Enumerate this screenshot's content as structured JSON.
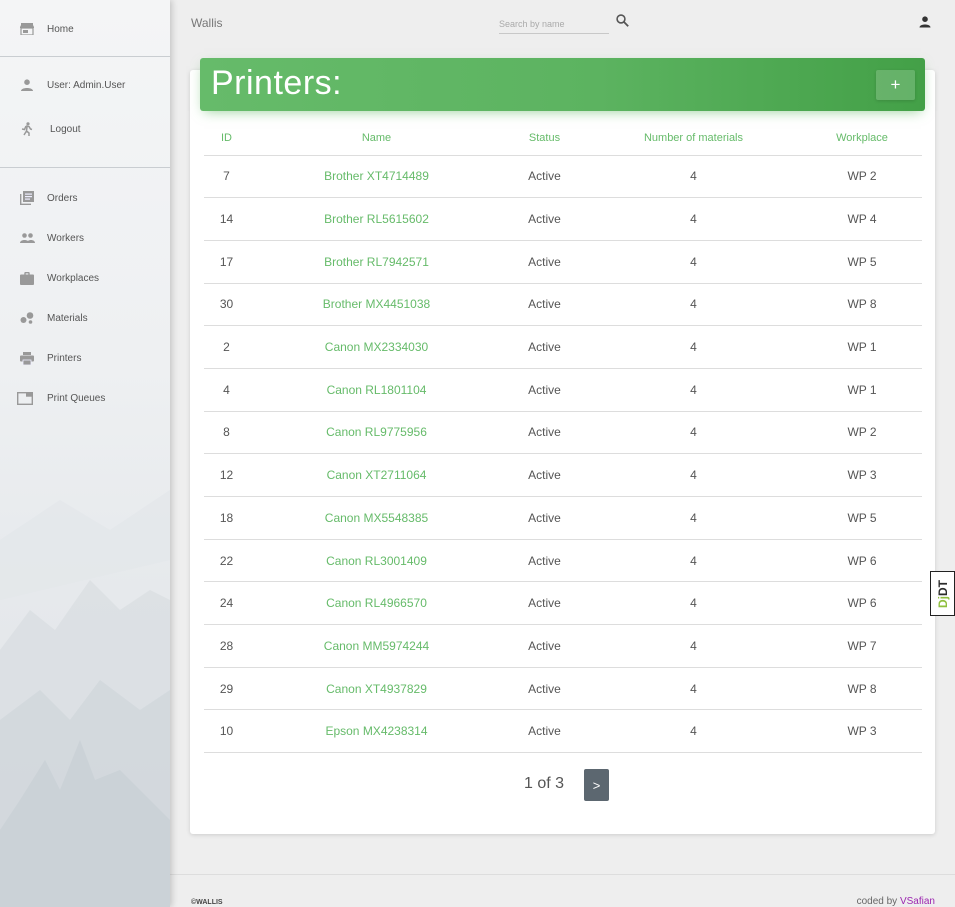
{
  "app": {
    "brand": "Wallis"
  },
  "sidebar": {
    "top_items": [
      {
        "label": "Home",
        "icon": "store-icon"
      }
    ],
    "user_items": [
      {
        "label": "User: Admin.User",
        "icon": "person-icon"
      },
      {
        "label": "Logout",
        "icon": "walk-icon"
      }
    ],
    "nav_items": [
      {
        "label": "Orders",
        "icon": "library-icon"
      },
      {
        "label": "Workers",
        "icon": "people-icon"
      },
      {
        "label": "Workplaces",
        "icon": "briefcase-icon"
      },
      {
        "label": "Materials",
        "icon": "bubble-chart-icon"
      },
      {
        "label": "Printers",
        "icon": "printer-icon"
      },
      {
        "label": "Print Queues",
        "icon": "queue-icon"
      }
    ]
  },
  "search": {
    "placeholder": "Search by name",
    "value": ""
  },
  "page": {
    "title": "Printers:",
    "add_label": "+"
  },
  "table": {
    "headers": [
      "ID",
      "Name",
      "Status",
      "Number of materials",
      "Workplace"
    ],
    "rows": [
      {
        "id": "7",
        "name": "Brother XT4714489",
        "status": "Active",
        "materials": "4",
        "workplace": "WP 2"
      },
      {
        "id": "14",
        "name": "Brother RL5615602",
        "status": "Active",
        "materials": "4",
        "workplace": "WP 4"
      },
      {
        "id": "17",
        "name": "Brother RL7942571",
        "status": "Active",
        "materials": "4",
        "workplace": "WP 5"
      },
      {
        "id": "30",
        "name": "Brother MX4451038",
        "status": "Active",
        "materials": "4",
        "workplace": "WP 8"
      },
      {
        "id": "2",
        "name": "Canon MX2334030",
        "status": "Active",
        "materials": "4",
        "workplace": "WP 1"
      },
      {
        "id": "4",
        "name": "Canon RL1801104",
        "status": "Active",
        "materials": "4",
        "workplace": "WP 1"
      },
      {
        "id": "8",
        "name": "Canon RL9775956",
        "status": "Active",
        "materials": "4",
        "workplace": "WP 2"
      },
      {
        "id": "12",
        "name": "Canon XT2711064",
        "status": "Active",
        "materials": "4",
        "workplace": "WP 3"
      },
      {
        "id": "18",
        "name": "Canon MX5548385",
        "status": "Active",
        "materials": "4",
        "workplace": "WP 5"
      },
      {
        "id": "22",
        "name": "Canon RL3001409",
        "status": "Active",
        "materials": "4",
        "workplace": "WP 6"
      },
      {
        "id": "24",
        "name": "Canon RL4966570",
        "status": "Active",
        "materials": "4",
        "workplace": "WP 6"
      },
      {
        "id": "28",
        "name": "Canon MM5974244",
        "status": "Active",
        "materials": "4",
        "workplace": "WP 7"
      },
      {
        "id": "29",
        "name": "Canon XT4937829",
        "status": "Active",
        "materials": "4",
        "workplace": "WP 8"
      },
      {
        "id": "10",
        "name": "Epson MX4238314",
        "status": "Active",
        "materials": "4",
        "workplace": "WP 3"
      }
    ]
  },
  "pagination": {
    "text": "1 of 3",
    "next_label": ">"
  },
  "footer": {
    "copyright": "©WALLIS",
    "coded_by": "coded by",
    "author": "VSafian"
  },
  "debug_toolbar": {
    "label_a": "Dj",
    "label_b": "DT"
  },
  "colors": {
    "accent": "#66bb6a",
    "header_green": "#4caf50",
    "author": "#9c27b0",
    "pager_button": "#5c6770"
  }
}
